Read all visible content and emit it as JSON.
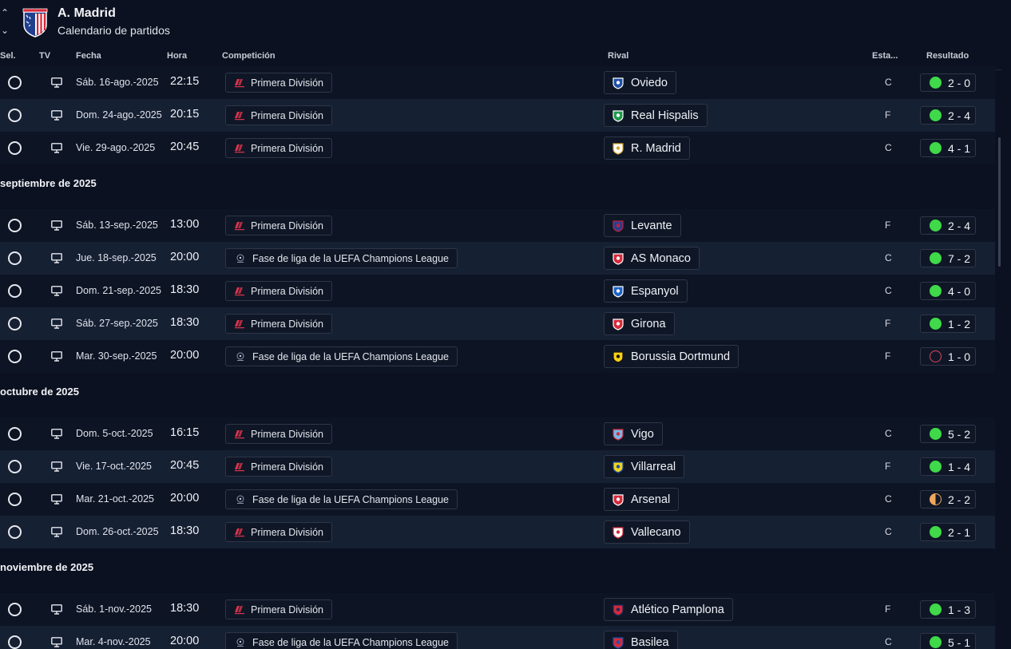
{
  "header": {
    "team": "A. Madrid",
    "subtitle": "Calendario de partidos",
    "collapse_up_glyph": "⌃",
    "collapse_down_glyph": "⌄"
  },
  "columns": {
    "sel": "Sel.",
    "tv": "TV",
    "fecha": "Fecha",
    "hora": "Hora",
    "competicion": "Competición",
    "rival": "Rival",
    "estado": "Esta...",
    "resultado": "Resultado"
  },
  "competitions": {
    "liga": {
      "label": "Primera División",
      "icon": "laliga-icon"
    },
    "ucl": {
      "label": "Fase de liga de la UEFA Champions League",
      "icon": "ucl-icon"
    }
  },
  "colors": {
    "win": "#3fd94a",
    "loss": "#e0455a",
    "draw": "#f2a65a",
    "background": "#0b1120",
    "row_alt": "#162033"
  },
  "rows": [
    {
      "kind": "match",
      "date": "Sáb. 16-ago.-2025",
      "time": "22:15",
      "comp": "liga",
      "rival": "Oviedo",
      "badge": "oviedo-badge-icon",
      "venue": "C",
      "outcome": "win",
      "score": "2 - 0"
    },
    {
      "kind": "match",
      "date": "Dom. 24-ago.-2025",
      "time": "20:15",
      "comp": "liga",
      "rival": "Real Hispalis",
      "badge": "hispalis-badge-icon",
      "venue": "F",
      "outcome": "win",
      "score": "2 - 4"
    },
    {
      "kind": "match",
      "date": "Vie. 29-ago.-2025",
      "time": "20:45",
      "comp": "liga",
      "rival": "R. Madrid",
      "badge": "rmadrid-badge-icon",
      "venue": "C",
      "outcome": "win",
      "score": "4 - 1"
    },
    {
      "kind": "month",
      "label": "septiembre de 2025"
    },
    {
      "kind": "match",
      "date": "Sáb. 13-sep.-2025",
      "time": "13:00",
      "comp": "liga",
      "rival": "Levante",
      "badge": "levante-badge-icon",
      "venue": "F",
      "outcome": "win",
      "score": "2 - 4"
    },
    {
      "kind": "match",
      "date": "Jue. 18-sep.-2025",
      "time": "20:00",
      "comp": "ucl",
      "rival": "AS Monaco",
      "badge": "monaco-badge-icon",
      "venue": "C",
      "outcome": "win",
      "score": "7 - 2"
    },
    {
      "kind": "match",
      "date": "Dom. 21-sep.-2025",
      "time": "18:30",
      "comp": "liga",
      "rival": "Espanyol",
      "badge": "espanyol-badge-icon",
      "venue": "C",
      "outcome": "win",
      "score": "4 - 0"
    },
    {
      "kind": "match",
      "date": "Sáb. 27-sep.-2025",
      "time": "18:30",
      "comp": "liga",
      "rival": "Girona",
      "badge": "girona-badge-icon",
      "venue": "F",
      "outcome": "win",
      "score": "1 - 2"
    },
    {
      "kind": "match",
      "date": "Mar. 30-sep.-2025",
      "time": "20:00",
      "comp": "ucl",
      "rival": "Borussia Dortmund",
      "badge": "dortmund-badge-icon",
      "venue": "F",
      "outcome": "loss",
      "score": "1 - 0"
    },
    {
      "kind": "month",
      "label": "octubre de 2025"
    },
    {
      "kind": "match",
      "date": "Dom. 5-oct.-2025",
      "time": "16:15",
      "comp": "liga",
      "rival": "Vigo",
      "badge": "vigo-badge-icon",
      "venue": "C",
      "outcome": "win",
      "score": "5 - 2"
    },
    {
      "kind": "match",
      "date": "Vie. 17-oct.-2025",
      "time": "20:45",
      "comp": "liga",
      "rival": "Villarreal",
      "badge": "villarreal-badge-icon",
      "venue": "F",
      "outcome": "win",
      "score": "1 - 4"
    },
    {
      "kind": "match",
      "date": "Mar. 21-oct.-2025",
      "time": "20:00",
      "comp": "ucl",
      "rival": "Arsenal",
      "badge": "arsenal-badge-icon",
      "venue": "C",
      "outcome": "draw",
      "score": "2 - 2"
    },
    {
      "kind": "match",
      "date": "Dom. 26-oct.-2025",
      "time": "18:30",
      "comp": "liga",
      "rival": "Vallecano",
      "badge": "vallecano-badge-icon",
      "venue": "C",
      "outcome": "win",
      "score": "2 - 1"
    },
    {
      "kind": "month",
      "label": "noviembre de 2025"
    },
    {
      "kind": "match",
      "date": "Sáb. 1-nov.-2025",
      "time": "18:30",
      "comp": "liga",
      "rival": "Atlético Pamplona",
      "badge": "pamplona-badge-icon",
      "venue": "F",
      "outcome": "win",
      "score": "1 - 3"
    },
    {
      "kind": "match",
      "date": "Mar. 4-nov.-2025",
      "time": "20:00",
      "comp": "ucl",
      "rival": "Basilea",
      "badge": "basilea-badge-icon",
      "venue": "C",
      "outcome": "win",
      "score": "5 - 1"
    }
  ]
}
